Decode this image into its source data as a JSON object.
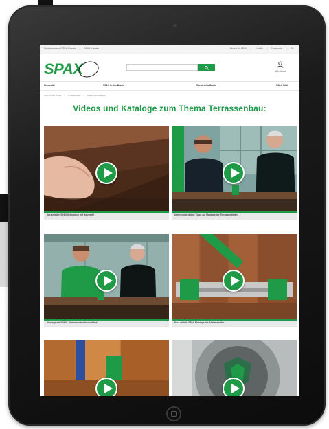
{
  "util_bar": {
    "left_items": [
      "Spaxdeutschland SPAX Schweiz",
      "SPAX· Händler"
    ],
    "right_items": [
      "Service für SPAX",
      "Kontakt",
      "Downloads",
      "DE"
    ]
  },
  "header": {
    "logo_text": "SPAX",
    "search_placeholder": "",
    "account_label": "Mein Konto"
  },
  "nav": {
    "items": [
      "Startseite",
      "SPAX in der Praxis",
      "Service für Profis",
      "SPAX Welt"
    ]
  },
  "breadcrumb": [
    "SPAX in der Praxis",
    "Terrassenbau",
    "Videos und Kataloge"
  ],
  "page": {
    "title": "Videos und Kataloge zum Thema Terrassenbau:"
  },
  "videos": [
    {
      "caption": "Kurz erklärt: SPAX Schrauben mit Holzprofil"
    },
    {
      "caption": "Unterkonstruktion: Tipps zur Montage der Terrassendielen"
    },
    {
      "caption": "Montage mit SPAX – Unterkonstruktion mit Holz"
    },
    {
      "caption": "Kurz erklärt: SPAX Montage mit Abstandhalter"
    },
    {
      "caption": ""
    },
    {
      "caption": ""
    }
  ],
  "colors": {
    "brand_green": "#1f9a46",
    "device_black": "#111111"
  },
  "icons": {
    "search": "search-icon",
    "account": "user-icon",
    "play": "play-icon"
  }
}
